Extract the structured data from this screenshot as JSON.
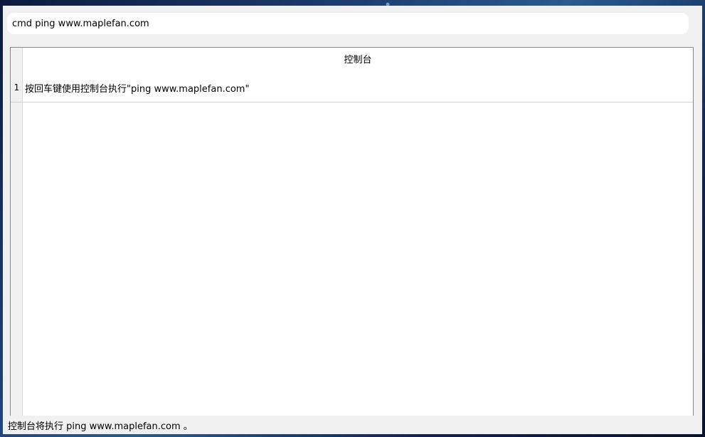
{
  "search": {
    "value": "cmd ping www.maplefan.com"
  },
  "console": {
    "header": "控制台",
    "rows": [
      {
        "number": "1",
        "text": "按回车键使用控制台执行\"ping www.maplefan.com\""
      }
    ]
  },
  "status": {
    "text": "控制台将执行 ping www.maplefan.com 。"
  }
}
